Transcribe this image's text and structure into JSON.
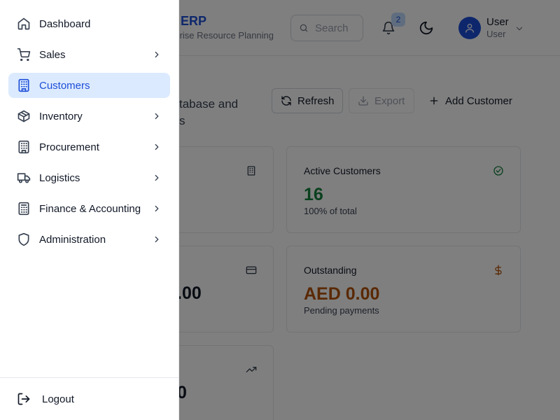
{
  "header": {
    "brand_title": "ERP",
    "brand_subtitle": "rise Resource Planning",
    "search_placeholder": "Search",
    "notification_count": "2",
    "user_name": "User",
    "user_role": "User"
  },
  "page": {
    "description_line1": "tabase and",
    "description_line2": "s"
  },
  "actions": {
    "refresh_label": "Refresh",
    "export_label": "Export",
    "add_label": "Add Customer"
  },
  "cards": {
    "active": {
      "title": "Active Customers",
      "value": "16",
      "sub": "100% of total",
      "color": "#15803d"
    },
    "outstanding": {
      "title": "Outstanding",
      "value": "AED 0.00",
      "sub": "Pending payments",
      "color": "#b45309"
    },
    "partial_revenue": {
      "value": ".00"
    },
    "partial_third": {
      "value": "0"
    }
  },
  "sidebar": {
    "items": [
      {
        "label": "Dashboard",
        "icon": "home-icon",
        "has_submenu": false,
        "active": false
      },
      {
        "label": "Sales",
        "icon": "cart-icon",
        "has_submenu": true,
        "active": false
      },
      {
        "label": "Customers",
        "icon": "building-icon",
        "has_submenu": false,
        "active": true
      },
      {
        "label": "Inventory",
        "icon": "package-icon",
        "has_submenu": true,
        "active": false
      },
      {
        "label": "Procurement",
        "icon": "building-icon",
        "has_submenu": true,
        "active": false
      },
      {
        "label": "Logistics",
        "icon": "truck-icon",
        "has_submenu": true,
        "active": false
      },
      {
        "label": "Finance & Accounting",
        "icon": "calculator-icon",
        "has_submenu": true,
        "active": false
      },
      {
        "label": "Administration",
        "icon": "shield-icon",
        "has_submenu": true,
        "active": false
      }
    ],
    "logout_label": "Logout"
  },
  "colors": {
    "accent": "#1d4ed8",
    "active_bg": "#dbeafe",
    "success": "#15803d",
    "warning": "#b45309",
    "overlay": "rgba(0,0,0,0.5)"
  }
}
